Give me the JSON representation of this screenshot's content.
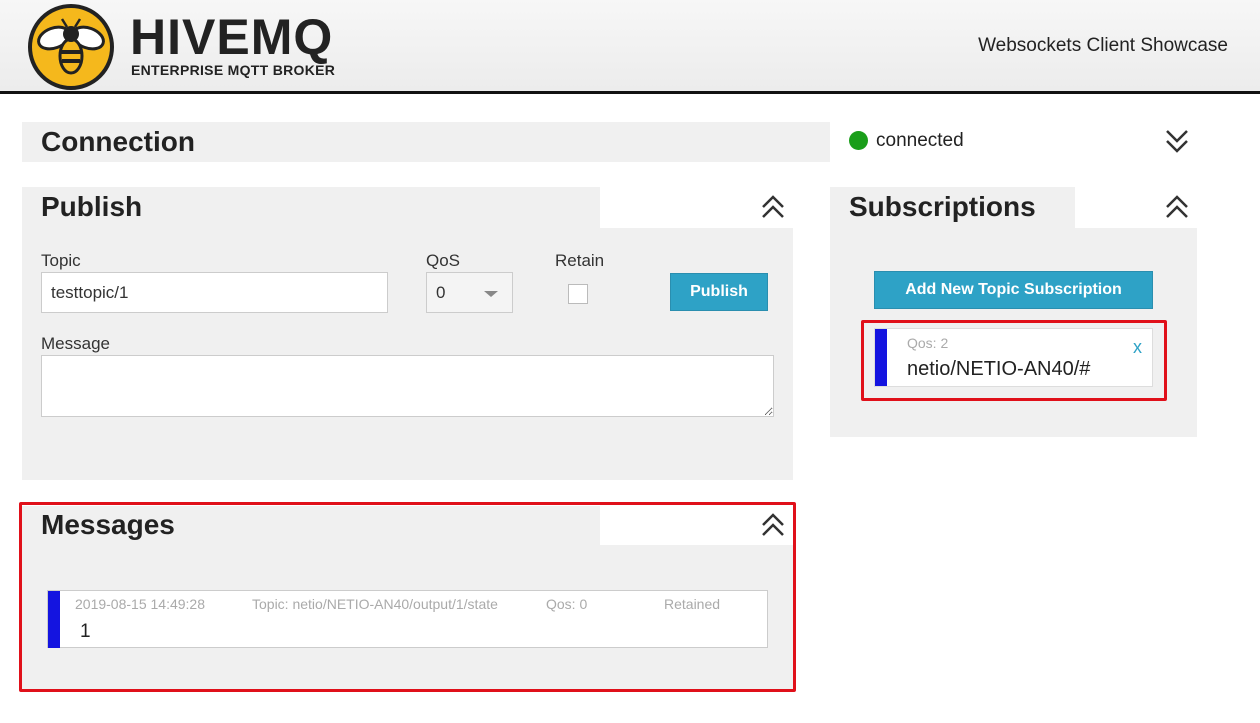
{
  "header": {
    "logo_title": "HIVEMQ",
    "logo_subtitle": "ENTERPRISE MQTT BROKER",
    "right_text": "Websockets Client Showcase"
  },
  "connection": {
    "title": "Connection",
    "status": "connected",
    "status_color": "#1a9e1a"
  },
  "publish": {
    "title": "Publish",
    "topic_label": "Topic",
    "topic_value": "testtopic/1",
    "qos_label": "QoS",
    "qos_value": "0",
    "retain_label": "Retain",
    "retain_checked": false,
    "message_label": "Message",
    "message_value": "",
    "publish_button": "Publish"
  },
  "subscriptions": {
    "title": "Subscriptions",
    "add_button": "Add New Topic Subscription",
    "items": [
      {
        "qos": "Qos: 2",
        "topic": "netio/NETIO-AN40/#",
        "remove": "x",
        "color": "#1414e0"
      }
    ]
  },
  "messages": {
    "title": "Messages",
    "items": [
      {
        "timestamp": "2019-08-15 14:49:28",
        "topic": "Topic: netio/NETIO-AN40/output/1/state",
        "qos": "Qos: 0",
        "retained": "Retained",
        "payload": "1",
        "color": "#1414e0"
      }
    ]
  },
  "colors": {
    "accent": "#2ea2c6",
    "highlight": "#e0101a",
    "panel_bg": "#f0f0f0"
  }
}
